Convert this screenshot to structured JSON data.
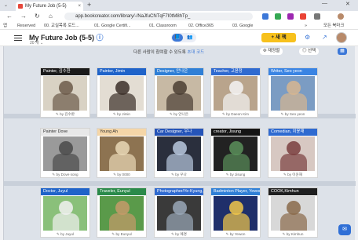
{
  "browser": {
    "tab_title": "My Future Job (5-5)",
    "tab_close": "×",
    "tab_menu": "⌄",
    "new_tab": "+",
    "min": "—",
    "close": "✕",
    "url": "app.bookcreator.com/library/-/NaJfuCNTqF7I0tM8hTp_",
    "nav": {
      "back": "←",
      "forward": "→",
      "reload": "↻",
      "home": "⌂"
    },
    "bookmarks": [
      "앱",
      "Reserved",
      "00. 교실목록 로드...",
      "01. Google Certifi...",
      "01. Classroom",
      "02. Office365",
      "03. Google"
    ],
    "bookmarks_more": "»",
    "all_bookmarks": "모든 북마크",
    "accent_colors": {
      "favicon": "#e6473b",
      "ext1": "#3c78d8",
      "ext2": "#34a853",
      "ext3": "#9c27b0",
      "ext4": "#ea4335"
    }
  },
  "app": {
    "title": "My Future Job (5-5)",
    "title_icon": "ⓘ",
    "post_count": "20 개 ⌄",
    "view_toggle": {
      "library": "📘",
      "people": "👥"
    },
    "new_button": "+ 새 책",
    "settings_icon": "⚙",
    "share_icon": "↗",
    "notice": "다른 사람이 참여할 수 있도록",
    "notice_link": "초대 코드",
    "invite_button": "✣ 재정렬",
    "select_button": "◎ 선택",
    "grid_icon": "▦",
    "chat_icon": "✉"
  },
  "books": [
    {
      "title": "Painter, 김수환",
      "author": "by 김수환",
      "band": "#1a1a1a",
      "img": "#d9d2c4",
      "fig": "#6b5a4a"
    },
    {
      "title": "Painter, Jimin",
      "author": "by Jimin",
      "band": "#1f63c9",
      "img": "#e3ddd3",
      "fig": "#3b2f28"
    },
    {
      "title": "Designer, 안나은",
      "author": "by 안나은",
      "band": "#2f7fd6",
      "img": "#c7b9a4",
      "fig": "#4a3d33"
    },
    {
      "title": "Teacher, 고윤정",
      "author": "by Daeon Kim",
      "band": "#2f6ad0",
      "img": "#b9a48c",
      "fig": "#f4f4f4"
    },
    {
      "title": "Writer, Seo yeon",
      "author": "by Seo yeon",
      "band": "#3a84e3",
      "img": "#7b9cc3",
      "fig": "#d7b690"
    },
    {
      "title": "Painter Dove",
      "author": "by Dove song",
      "band": "#e8e8e8",
      "img": "#9a9a9a",
      "fig": "#4a4a4a"
    },
    {
      "title": "Young Ah",
      "author": "by 0000",
      "band": "#f5d6a8",
      "img": "#8d7351",
      "fig": "#e9d8b6"
    },
    {
      "title": "Car Designer, 우나",
      "author": "by 우나",
      "band": "#2554b8",
      "img": "#2a2f3d",
      "fig": "#b8c8de"
    },
    {
      "title": "creator, Jisung",
      "author": "by Jisung",
      "band": "#151515",
      "img": "#222222",
      "fig": "#5a8f5a"
    },
    {
      "title": "Comedian, 이윤재",
      "author": "by 이윤재",
      "band": "#2f6ad0",
      "img": "#d7c8c2",
      "fig": "#7a3e3e"
    },
    {
      "title": "Doctor, Juyul",
      "author": "by Juyul",
      "band": "#1f63c9",
      "img": "#8ac07a",
      "fig": "#f1f1f1"
    },
    {
      "title": "Traveler, Eunyul",
      "author": "by Eunyul",
      "band": "#2a8a4a",
      "img": "#5a9a4a",
      "fig": "#c69a6a"
    },
    {
      "title": "Photographer/Ye-Kyung, 예경",
      "author": "by 예경",
      "band": "#2f6ad0",
      "img": "#3a3a3a",
      "fig": "#9aa8b8"
    },
    {
      "title": "Badminton Player, Yewon",
      "author": "by Yewon",
      "band": "#2f7fd6",
      "img": "#1f2f6a",
      "fig": "#f2c84a"
    },
    {
      "title": "COOK,Kimhun",
      "author": "by Kimhun",
      "band": "#1f1f1f",
      "img": "#d8d8d8",
      "fig": "#8a6a4a"
    }
  ]
}
